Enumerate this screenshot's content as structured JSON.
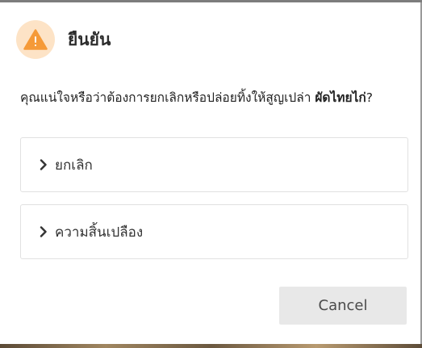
{
  "dialog": {
    "title": "ยืนยัน",
    "icon": "warning-icon",
    "message_prefix": "คุณแน่ใจหรือว่าต้องการยกเลิกหรือปล่อยทิ้งให้สูญเปล่า ",
    "message_bold": "ผัดไทยไก่",
    "message_suffix": "?",
    "options": [
      {
        "label": "ยกเลิก"
      },
      {
        "label": "ความสิ้นเปลือง"
      }
    ],
    "cancel_label": "Cancel"
  },
  "colors": {
    "accent": "#f59a38",
    "accent_bg": "#fde3c6"
  }
}
